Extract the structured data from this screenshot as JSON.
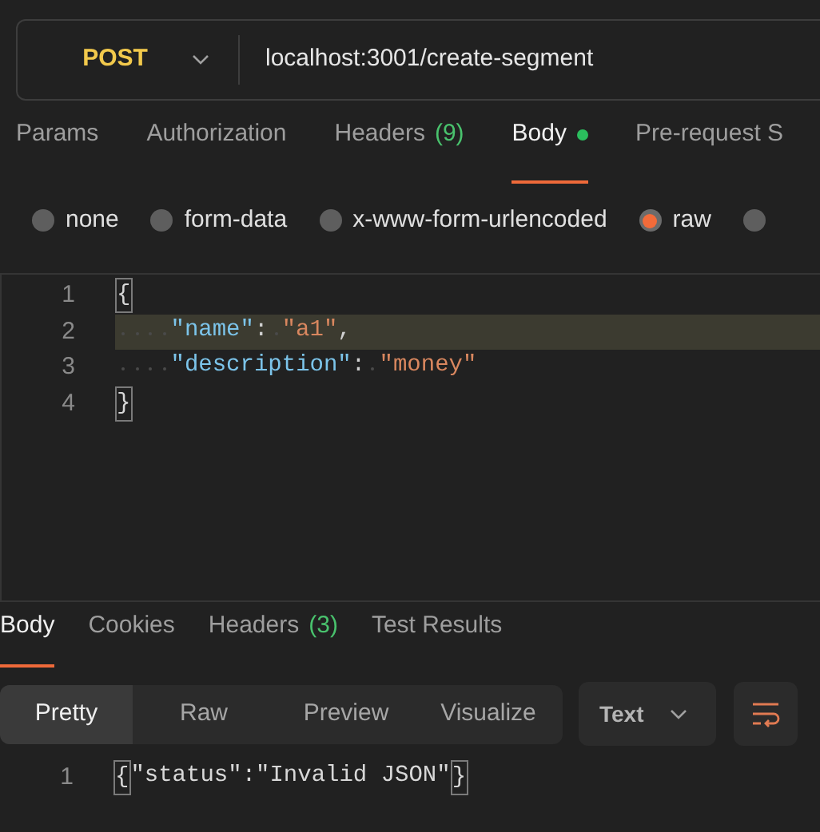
{
  "request": {
    "method": "POST",
    "url": "localhost:3001/create-segment"
  },
  "request_tabs": [
    {
      "label": "Params",
      "selected": false
    },
    {
      "label": "Authorization",
      "selected": false
    },
    {
      "label": "Headers",
      "count": "(9)",
      "selected": false
    },
    {
      "label": "Body",
      "selected": true,
      "dot": true
    },
    {
      "label": "Pre-request S",
      "selected": false
    }
  ],
  "body_types": [
    {
      "label": "none",
      "selected": false
    },
    {
      "label": "form-data",
      "selected": false
    },
    {
      "label": "x-www-form-urlencoded",
      "selected": false
    },
    {
      "label": "raw",
      "selected": true
    },
    {
      "selected": false
    }
  ],
  "editor": {
    "lines": [
      {
        "number": "1",
        "highlighted": false,
        "tokens": [
          {
            "kind": "bracket",
            "text": "{"
          }
        ]
      },
      {
        "number": "2",
        "highlighted": true,
        "tokens": [
          {
            "kind": "indent"
          },
          {
            "kind": "key",
            "text": "\"name\""
          },
          {
            "kind": "punct",
            "text": ":"
          },
          {
            "kind": "gap"
          },
          {
            "kind": "string",
            "text": "\"a1\""
          },
          {
            "kind": "punct",
            "text": ","
          }
        ]
      },
      {
        "number": "3",
        "highlighted": false,
        "tokens": [
          {
            "kind": "indent"
          },
          {
            "kind": "key",
            "text": "\"description\""
          },
          {
            "kind": "punct",
            "text": ":"
          },
          {
            "kind": "gap"
          },
          {
            "kind": "string",
            "text": "\"money\""
          }
        ]
      },
      {
        "number": "4",
        "highlighted": false,
        "tokens": [
          {
            "kind": "bracket",
            "text": "}"
          }
        ]
      }
    ]
  },
  "response_tabs": [
    {
      "label": "Body",
      "selected": true
    },
    {
      "label": "Cookies",
      "selected": false
    },
    {
      "label": "Headers",
      "count": "(3)",
      "selected": false
    },
    {
      "label": "Test Results",
      "selected": false
    }
  ],
  "view_modes": [
    {
      "label": "Pretty",
      "selected": true
    },
    {
      "label": "Raw",
      "selected": false
    },
    {
      "label": "Preview",
      "selected": false
    },
    {
      "label": "Visualize",
      "selected": false
    }
  ],
  "format": "Text",
  "response": {
    "lines": [
      {
        "number": "1",
        "tokens": [
          {
            "kind": "bracket",
            "text": "{"
          },
          {
            "kind": "plain",
            "text": "\"status\":\"Invalid JSON\""
          },
          {
            "kind": "bracket",
            "text": "}"
          }
        ]
      }
    ]
  }
}
